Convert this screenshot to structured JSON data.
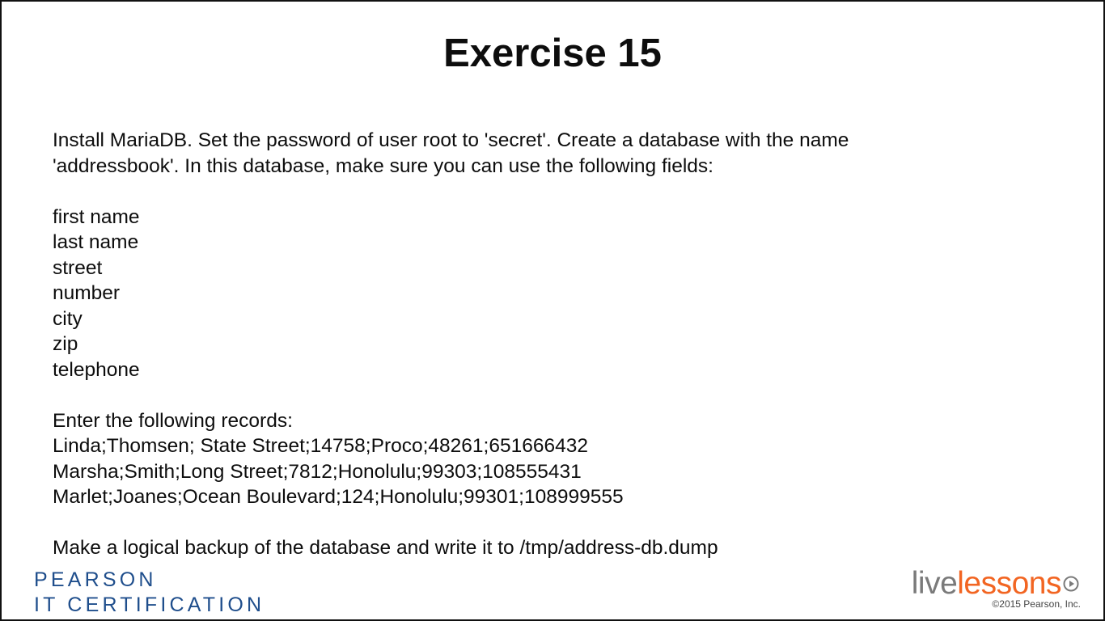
{
  "title": "Exercise 15",
  "intro": [
    "Install MariaDB. Set the password of user root to 'secret'. Create a database with the name",
    "'addressbook'. In this database, make sure you can use the following fields:"
  ],
  "fields": [
    "first name",
    "last name",
    "street",
    "number",
    "city",
    "zip",
    "telephone"
  ],
  "records_heading": "Enter the following records:",
  "records": [
    "Linda;Thomsen; State Street;14758;Proco;48261;651666432",
    "Marsha;Smith;Long Street;7812;Honolulu;99303;108555431",
    "Marlet;Joanes;Ocean Boulevard;124;Honolulu;99301;108999555"
  ],
  "backup_instruction": "Make a logical backup of the database and write it to /tmp/address-db.dump",
  "branding": {
    "pearson_line1": "PEARSON",
    "pearson_line2": "IT CERTIFICATION",
    "pearson_color": "#1f4e8c",
    "live_part": "live",
    "lessons_part": "lessons",
    "lessons_color": "#f26522",
    "logo_icon": "play-circle-icon",
    "copyright": "©2015 Pearson, Inc."
  }
}
